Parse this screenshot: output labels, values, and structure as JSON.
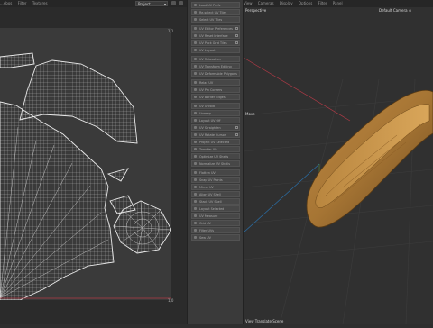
{
  "topbar": {
    "left_menus": [
      "...ebos",
      "Filter",
      "Textures"
    ],
    "project_select": "Project",
    "right_menus": [
      "View",
      "Cameras",
      "Display",
      "Options",
      "Filter",
      "Panel"
    ]
  },
  "uv_editor": {
    "label_top_right": "1,1",
    "label_bottom_right": "1,0"
  },
  "middle_panel": {
    "rows": [
      "Load UV Prefs",
      "Re-select UV Tiles",
      "Select UV Tiles",
      "UV Editor Preferences",
      "UV Reset Interface",
      "UV Pack Grid Tiles",
      "UV Layout",
      "UV Relaxation",
      "UV Transform Editing",
      "UV Deformable Polygons",
      "Relax UV",
      "UV Pin Corners",
      "UV Border Edges",
      "UV Unfold",
      "Unwrap",
      "Layout UV Off",
      "UV Straighten",
      "UV Rotate Cursor",
      "Project UV Selected",
      "Transfer UV",
      "Optimize UV Shells",
      "Normalize UV Shells",
      "Flatten UV",
      "Snap UV Points",
      "Mirror UV",
      "Align UV Shell",
      "Stack UV Shell",
      "Layout Selected",
      "UV Measure",
      "Grid UV",
      "Filter UVs",
      "Sew UV"
    ]
  },
  "viewport": {
    "view_label": "Perspective",
    "camera_label": "Default Camera",
    "tool_label": "Move",
    "status_text": "View Translate Scene"
  },
  "colors": {
    "axis_x": "#b03a46",
    "axis_z": "#2a6fa8",
    "axis_y": "#5a9a3a",
    "object_main": "#a67534",
    "uv_lines": "#d0d0d0"
  }
}
